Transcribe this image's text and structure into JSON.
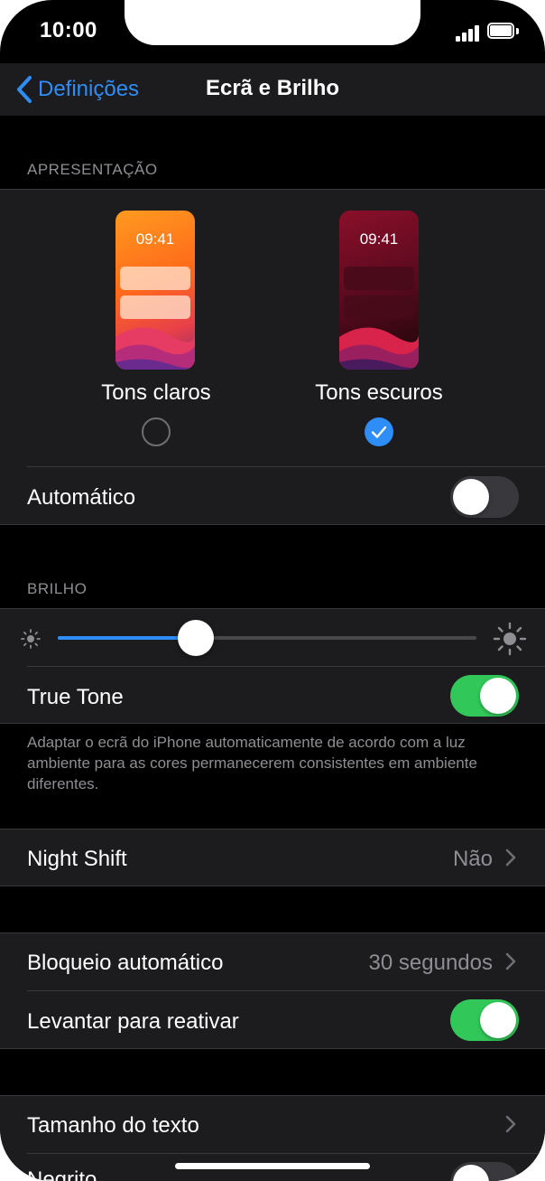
{
  "status_bar": {
    "time": "10:00"
  },
  "nav": {
    "back_label": "Definições",
    "title": "Ecrã e Brilho"
  },
  "appearance": {
    "header": "APRESENTAÇÃO",
    "light": {
      "preview_time": "09:41",
      "label": "Tons claros",
      "selected": false
    },
    "dark": {
      "preview_time": "09:41",
      "label": "Tons escuros",
      "selected": true
    },
    "automatic_label": "Automático",
    "automatic_on": false
  },
  "brightness": {
    "header": "BRILHO",
    "level_fraction": 0.33,
    "true_tone_label": "True Tone",
    "true_tone_on": true,
    "footer": "Adaptar o ecrã do iPhone automaticamente de acordo com a luz ambiente para as cores permanecerem consistentes em ambiente diferentes."
  },
  "night_shift": {
    "label": "Night Shift",
    "value": "Não"
  },
  "lock": {
    "auto_lock_label": "Bloqueio automático",
    "auto_lock_value": "30 segundos",
    "raise_to_wake_label": "Levantar para reativar",
    "raise_to_wake_on": true
  },
  "text": {
    "text_size_label": "Tamanho do texto",
    "bold_label_partial": "Negrito",
    "bold_on": false
  },
  "colors": {
    "accent": "#2e8df6",
    "toggle_on": "#32c859",
    "toggle_off": "#39393d",
    "cell_background": "#1c1c1e",
    "background": "#000000",
    "secondary_text": "#8e8e93"
  }
}
